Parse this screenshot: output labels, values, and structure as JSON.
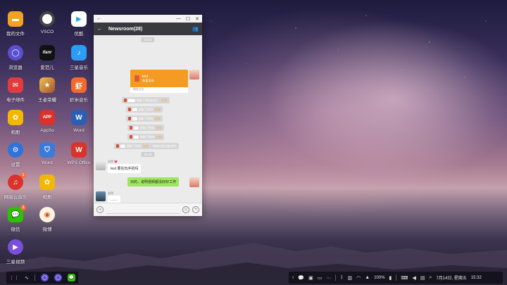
{
  "desktop": {
    "icons": [
      {
        "label": "我的文件",
        "icon": "folder-icon",
        "color": "#f2a320"
      },
      {
        "label": "VSCO",
        "icon": "vsco-icon",
        "color": "#ffffff"
      },
      {
        "label": "优酷",
        "icon": "youku-icon",
        "color": "#23a6e8"
      },
      {
        "label": "浏览器",
        "icon": "browser-icon",
        "color": "#5a4fcf"
      },
      {
        "label": "爱范儿",
        "icon": "ifanr-icon",
        "color": "#111111",
        "glyph": "ifanr"
      },
      {
        "label": "三星音乐",
        "icon": "music-icon",
        "color": "#2a9df4"
      },
      {
        "label": "电子邮件",
        "icon": "email-icon",
        "color": "#e23b3b"
      },
      {
        "label": "王者荣耀",
        "icon": "game-icon",
        "color": "#c07a2a"
      },
      {
        "label": "虾米音乐",
        "icon": "xiami-icon",
        "color": "#f46a2a",
        "glyph": "虾"
      },
      {
        "label": "相册",
        "icon": "gallery-icon",
        "color": "#f2b705"
      },
      {
        "label": "AppSo",
        "icon": "appso-icon",
        "color": "#d8322c",
        "glyph": "APP"
      },
      {
        "label": "Word",
        "icon": "word-icon",
        "color": "#2b5fb3",
        "glyph": "W"
      },
      {
        "label": "设置",
        "icon": "settings-icon",
        "color": "#2f74d9"
      },
      {
        "label": "Word",
        "icon": "shield-icon",
        "color": "#3b7ad9"
      },
      {
        "label": "WPS Office",
        "icon": "wps-icon",
        "color": "#d9342b",
        "glyph": "W"
      },
      {
        "label": "网易云音乐",
        "icon": "netease-music-icon",
        "color": "#d9342b",
        "badge": "1"
      },
      {
        "label": "相册",
        "icon": "gallery-icon",
        "color": "#f2b705"
      },
      {
        "label": "微信",
        "icon": "wechat-icon",
        "color": "#2dc100",
        "badge": "1"
      },
      {
        "label": "微博",
        "icon": "weibo-icon",
        "color": "#f5a623"
      },
      {
        "label": "三星视频",
        "icon": "video-icon",
        "color": "#7a4fd9"
      }
    ]
  },
  "chat": {
    "title": "Newsroom(28)",
    "times": [
      "15:22",
      "15:28"
    ],
    "red_packet": {
      "sender_line": "test",
      "note": "恭喜发财",
      "footer": "微信红包"
    },
    "system_msgs": [
      {
        "text": "领取了你的红包，",
        "hl": "红包"
      },
      {
        "text": "领取了你的",
        "hl": "红包"
      },
      {
        "text": "领取了你的",
        "hl": "红包"
      },
      {
        "text": "领取了你的",
        "hl": "红包"
      },
      {
        "text": "领取了你的",
        "hl": "红包"
      },
      {
        "text": "领取了你的",
        "hl": "红包",
        "tail": "，你的红包已被领完"
      }
    ],
    "msg1": {
      "sender": "觉得 💗",
      "text": "test 要在玩手机吗"
    },
    "msg2": {
      "text": "对的，说明视频都没好好工作"
    },
    "msg3": {
      "sender": "觉得",
      "text": "……"
    },
    "msg4": {
      "sender": "路过💗Vivi"
    }
  },
  "taskbar": {
    "battery": "100%",
    "date": "7月14日, 星期五",
    "time": "15:32"
  },
  "colors": {
    "chat_header": "#393a3f",
    "bubble_right": "#9ee65e",
    "red_packet": "#f59a23"
  }
}
